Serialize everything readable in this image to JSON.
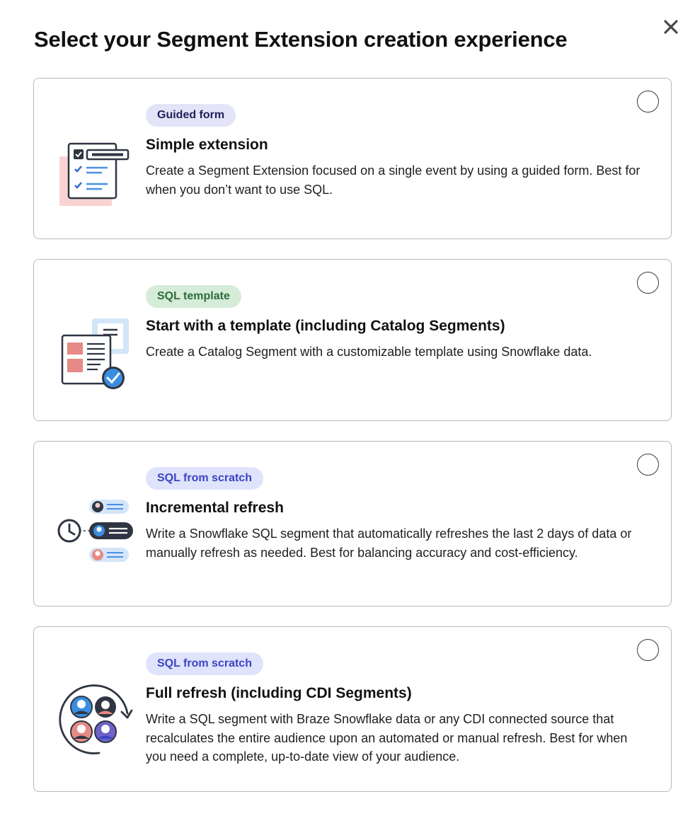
{
  "modal": {
    "title": "Select your Segment Extension creation experience",
    "close_icon": "close-icon"
  },
  "options": [
    {
      "badge": "Guided form",
      "title": "Simple extension",
      "description": "Create a Segment Extension focused on a single event by using a guided form. Best for when you don’t want to use SQL.",
      "selected": false
    },
    {
      "badge": "SQL template",
      "title": "Start with a template (including Catalog Segments)",
      "description": "Create a Catalog Segment with a customizable template using Snowflake data.",
      "selected": false
    },
    {
      "badge": "SQL from scratch",
      "title": "Incremental refresh",
      "description": "Write a Snowflake SQL segment that automatically refreshes the last 2 days of data or manually refresh as needed. Best for balancing accuracy and cost-efficiency.",
      "selected": false
    },
    {
      "badge": "SQL from scratch",
      "title": "Full refresh (including CDI Segments)",
      "description": "Write a SQL segment with Braze Snowflake data or any CDI connected source that recalculates the entire audience upon an automated or manual refresh. Best for when you need a complete, up-to-date view of your audience.",
      "selected": false
    }
  ],
  "colors": {
    "badge_guided_bg": "#e4e4f8",
    "badge_template_bg": "#d5ecd8",
    "badge_scratch_bg": "#dfe3fb",
    "card_border": "#b8b8bd"
  }
}
